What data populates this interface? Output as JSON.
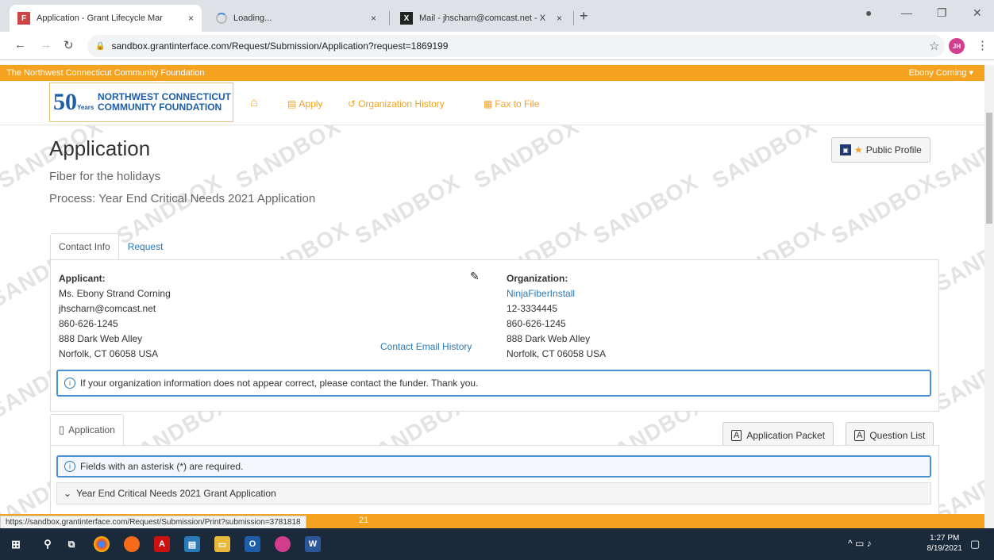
{
  "browser": {
    "tabs": [
      {
        "title": "Application - Grant Lifecycle Mar",
        "close": "×"
      },
      {
        "title": "Loading...",
        "close": "×"
      },
      {
        "title": "Mail - jhscharn@comcast.net - X",
        "close": "×"
      }
    ],
    "new_tab": "+",
    "url": "sandbox.grantinterface.com/Request/Submission/Application?request=1869199",
    "profile_initials": "JH",
    "status_url": "https://sandbox.grantinterface.com/Request/Submission/Print?submission=3781818"
  },
  "topbar": {
    "org": "The Northwest Connecticut Community Foundation",
    "user": "Ebony Corning ▾"
  },
  "logo": {
    "fifty": "50",
    "years": "Years",
    "line1": "NORTHWEST CONNECTICUT",
    "line2": "COMMUNITY FOUNDATION"
  },
  "nav": {
    "apply": "Apply",
    "org_history": "Organization History",
    "fax": "Fax to File"
  },
  "watermark": "SANDBOX",
  "page": {
    "title": "Application",
    "subtitle": "Fiber for the holidays",
    "process": "Process: Year End Critical Needs 2021 Application",
    "public_profile": "Public Profile"
  },
  "contact_tabs": {
    "contact": "Contact Info",
    "request": "Request"
  },
  "applicant": {
    "label": "Applicant:",
    "name": "Ms. Ebony Strand Corning",
    "email": "jhscharn@comcast.net",
    "phone": "860-626-1245",
    "address1": "888 Dark Web Alley",
    "address2": "Norfolk, CT 06058 USA",
    "email_history": "Contact Email History"
  },
  "organization": {
    "label": "Organization:",
    "name": "NinjaFiberInstall",
    "ein": "12-3334445",
    "phone": "860-626-1245",
    "address1": "888 Dark Web Alley",
    "address2": "Norfolk, CT 06058 USA"
  },
  "info_msg": "If your organization information does not appear correct, please contact the funder. Thank you.",
  "application": {
    "tab": "Application",
    "packet": "Application Packet",
    "question_list": "Question List",
    "required_msg": "Fields with an asterisk (*) are required.",
    "section": "Year End Critical Needs 2021 Grant Application",
    "partial_number": "21"
  },
  "taskbar": {
    "time": "1:27 PM",
    "date": "8/19/2021"
  }
}
